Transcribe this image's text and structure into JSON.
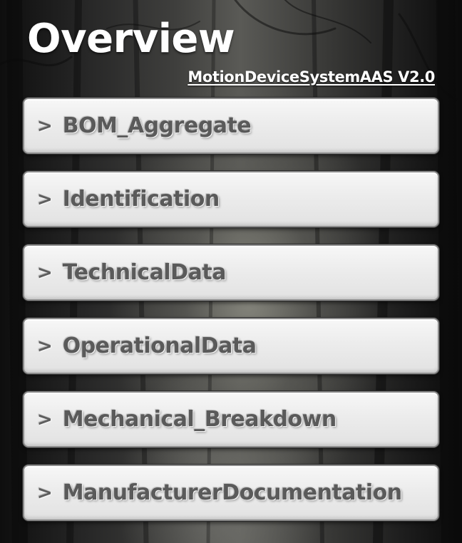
{
  "header": {
    "title": "Overview",
    "subtitle": "MotionDeviceSystemAAS V2.0"
  },
  "menu": {
    "chevron": ">",
    "items": [
      {
        "label": "BOM_Aggregate"
      },
      {
        "label": "Identification"
      },
      {
        "label": "TechnicalData"
      },
      {
        "label": "OperationalData"
      },
      {
        "label": "Mechanical_Breakdown"
      },
      {
        "label": "ManufacturerDocumentation"
      }
    ]
  },
  "colors": {
    "title_text": "#ffffff",
    "button_face": "#ececec",
    "button_text": "#5a5a5a"
  }
}
